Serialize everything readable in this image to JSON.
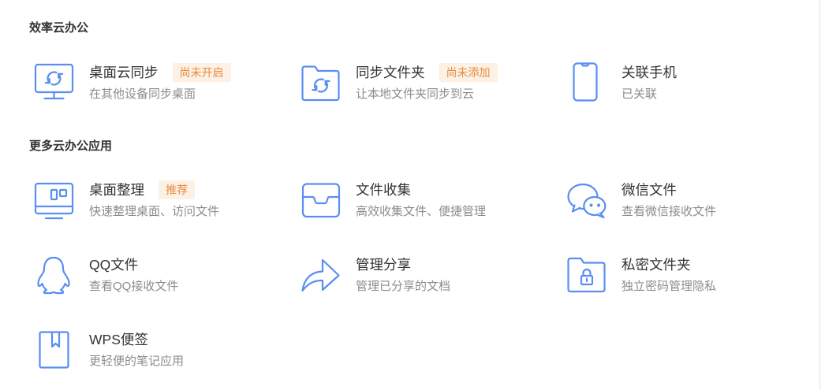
{
  "colors": {
    "accent": "#5a8ef0",
    "title": "#333333",
    "subtitle": "#8c8c8c",
    "badge_text": "#e98b3f",
    "badge_bg": "#fdf0e5"
  },
  "sections": [
    {
      "title": "效率云办公",
      "items": [
        {
          "icon": "desktop-sync-icon",
          "title": "桌面云同步",
          "badge": "尚未开启",
          "subtitle": "在其他设备同步桌面"
        },
        {
          "icon": "folder-sync-icon",
          "title": "同步文件夹",
          "badge": "尚未添加",
          "subtitle": "让本地文件夹同步到云"
        },
        {
          "icon": "phone-icon",
          "title": "关联手机",
          "subtitle": "已关联"
        }
      ]
    },
    {
      "title": "更多云办公应用",
      "items": [
        {
          "icon": "desktop-organize-icon",
          "title": "桌面整理",
          "badge": "推荐",
          "subtitle": "快速整理桌面、访问文件"
        },
        {
          "icon": "inbox-tray-icon",
          "title": "文件收集",
          "subtitle": "高效收集文件、便捷管理"
        },
        {
          "icon": "wechat-icon",
          "title": "微信文件",
          "subtitle": "查看微信接收文件"
        },
        {
          "icon": "qq-penguin-icon",
          "title": "QQ文件",
          "subtitle": "查看QQ接收文件"
        },
        {
          "icon": "share-arrow-icon",
          "title": "管理分享",
          "subtitle": "管理已分享的文档"
        },
        {
          "icon": "lock-folder-icon",
          "title": "私密文件夹",
          "subtitle": "独立密码管理隐私"
        },
        {
          "icon": "bookmark-note-icon",
          "title": "WPS便签",
          "subtitle": "更轻便的笔记应用"
        }
      ]
    }
  ]
}
